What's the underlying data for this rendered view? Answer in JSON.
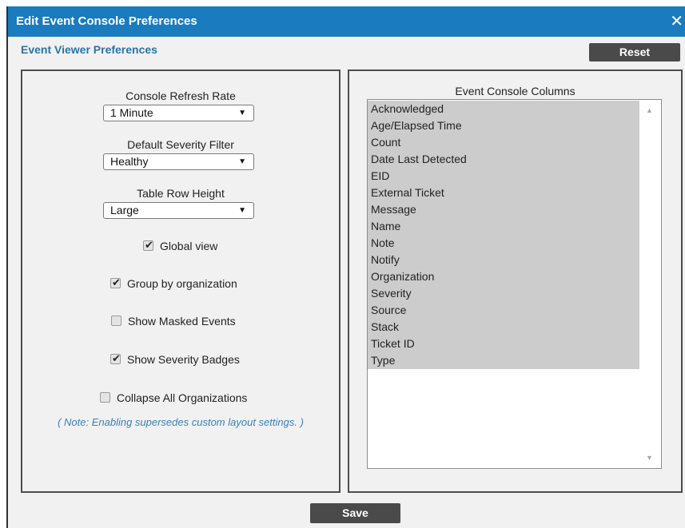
{
  "dialog": {
    "title": "Edit Event Console Preferences",
    "close_icon": "close-icon"
  },
  "section": {
    "heading": "Event Viewer Preferences"
  },
  "buttons": {
    "reset_label": "Reset",
    "save_label": "Save"
  },
  "preferences": {
    "refresh_rate": {
      "label": "Console Refresh Rate",
      "value": "1 Minute"
    },
    "severity_filter": {
      "label": "Default Severity Filter",
      "value": "Healthy"
    },
    "row_height": {
      "label": "Table Row Height",
      "value": "Large"
    },
    "dropdown_arrow": "▼",
    "checkboxes": [
      {
        "label": "Global view",
        "checked": true
      },
      {
        "label": "Group by organization",
        "checked": true
      },
      {
        "label": "Show Masked Events",
        "checked": false
      },
      {
        "label": "Show Severity Badges",
        "checked": true
      },
      {
        "label": "Collapse All Organizations",
        "checked": false
      }
    ],
    "note": "( Note: Enabling supersedes custom layout settings. )"
  },
  "columns": {
    "title": "Event Console Columns",
    "items": [
      "Acknowledged",
      "Age/Elapsed Time",
      "Count",
      "Date Last Detected",
      "EID",
      "External Ticket",
      "Message",
      "Name",
      "Note",
      "Notify",
      "Organization",
      "Severity",
      "Source",
      "Stack",
      "Ticket ID",
      "Type"
    ]
  },
  "colors": {
    "title_bar": "#1a7bbf",
    "button": "#4a4a4a",
    "selected_item": "#cccccc",
    "note_text": "#3c7fb4"
  }
}
